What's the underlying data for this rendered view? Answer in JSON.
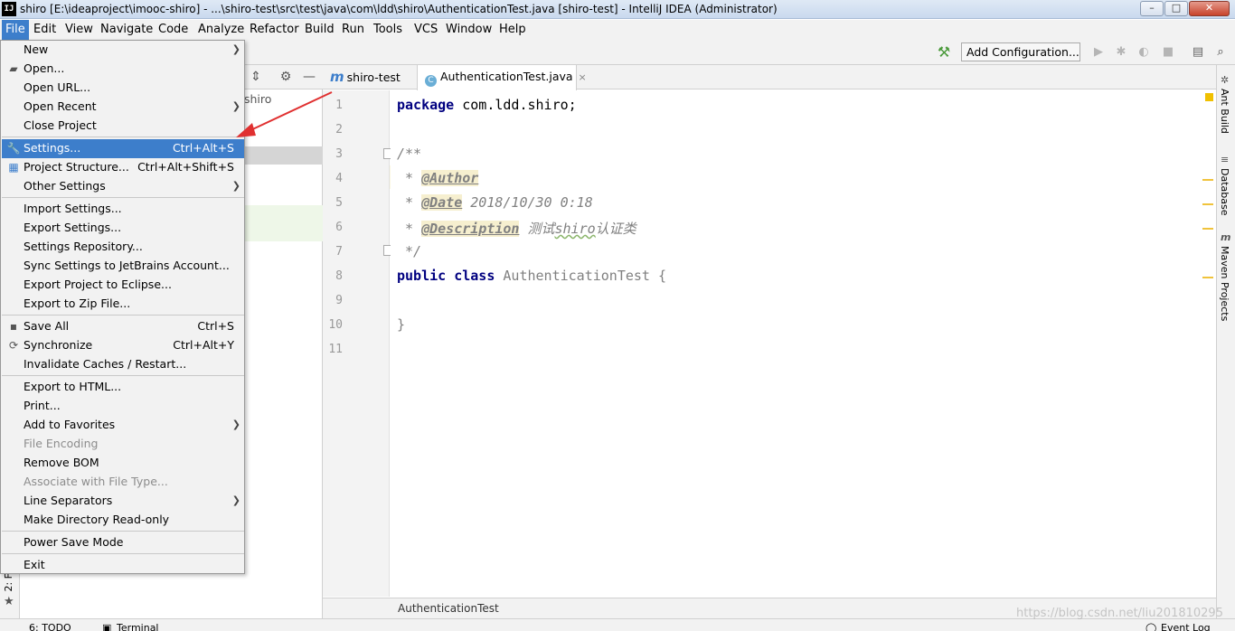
{
  "window": {
    "title": "shiro [E:\\ideaproject\\imooc-shiro] - ...\\shiro-test\\src\\test\\java\\com\\ldd\\shiro\\AuthenticationTest.java [shiro-test] - IntelliJ IDEA (Administrator)",
    "logo": "IJ",
    "min": "–",
    "max": "□",
    "close": "✕"
  },
  "menubar": [
    "File",
    "Edit",
    "View",
    "Navigate",
    "Code",
    "Analyze",
    "Refactor",
    "Build",
    "Run",
    "Tools",
    "VCS",
    "Window",
    "Help"
  ],
  "toolbar": {
    "add_configuration": "Add Configuration..."
  },
  "project": {
    "row_text": "shiro"
  },
  "tabs": [
    {
      "label": "shiro-test",
      "icon": "m"
    },
    {
      "label": "AuthenticationTest.java",
      "icon": "C",
      "close": "×"
    }
  ],
  "code": {
    "line_numbers": [
      "1",
      "2",
      "3",
      "4",
      "5",
      "6",
      "7",
      "8",
      "9",
      "10",
      "11"
    ],
    "line1_kw": "package",
    "line1_rest": " com.ldd.shiro;",
    "line3": "/**",
    "star": " * ",
    "author_tag": "@Author",
    "date_tag": "@Date",
    "date_value": " 2018/10/30 0:18",
    "desc_tag": "@Description",
    "desc_value_a": " 测试",
    "desc_value_b": "shiro",
    "desc_value_c": "认证类",
    "line7": " */",
    "line8_kw": "public class",
    "line8_name": " AuthenticationTest",
    "line8_brace": " {",
    "line10": "}"
  },
  "breadcrumb": "AuthenticationTest",
  "right_strip": [
    "Ant Build",
    "Database",
    "Maven Projects"
  ],
  "left_strip": "2: F",
  "bottombar": {
    "todo": "6: TODO",
    "terminal": "Terminal",
    "event_log": "Event Log"
  },
  "watermark": "https://blog.csdn.net/liu201810295",
  "file_menu": {
    "items": [
      {
        "label": "New",
        "shortcut": "",
        "submenu": true,
        "icon": ""
      },
      {
        "label": "Open...",
        "shortcut": "",
        "submenu": false,
        "icon": "folder-icon"
      },
      {
        "label": "Open URL...",
        "shortcut": "",
        "submenu": false,
        "icon": ""
      },
      {
        "label": "Open Recent",
        "shortcut": "",
        "submenu": true,
        "icon": ""
      },
      {
        "label": "Close Project",
        "shortcut": "",
        "submenu": false,
        "icon": ""
      },
      {
        "label": "Settings...",
        "shortcut": "Ctrl+Alt+S",
        "submenu": false,
        "icon": "wrench-icon",
        "selected": true
      },
      {
        "label": "Project Structure...",
        "shortcut": "Ctrl+Alt+Shift+S",
        "submenu": false,
        "icon": "project-structure-icon"
      },
      {
        "label": "Other Settings",
        "shortcut": "",
        "submenu": true,
        "icon": ""
      },
      {
        "label": "Import Settings...",
        "shortcut": "",
        "submenu": false,
        "icon": ""
      },
      {
        "label": "Export Settings...",
        "shortcut": "",
        "submenu": false,
        "icon": ""
      },
      {
        "label": "Settings Repository...",
        "shortcut": "",
        "submenu": false,
        "icon": ""
      },
      {
        "label": "Sync Settings to JetBrains Account...",
        "shortcut": "",
        "submenu": false,
        "icon": ""
      },
      {
        "label": "Export Project to Eclipse...",
        "shortcut": "",
        "submenu": false,
        "icon": ""
      },
      {
        "label": "Export to Zip File...",
        "shortcut": "",
        "submenu": false,
        "icon": ""
      },
      {
        "label": "Save All",
        "shortcut": "Ctrl+S",
        "submenu": false,
        "icon": "save-icon"
      },
      {
        "label": "Synchronize",
        "shortcut": "Ctrl+Alt+Y",
        "submenu": false,
        "icon": "sync-icon"
      },
      {
        "label": "Invalidate Caches / Restart...",
        "shortcut": "",
        "submenu": false,
        "icon": ""
      },
      {
        "label": "Export to HTML...",
        "shortcut": "",
        "submenu": false,
        "icon": ""
      },
      {
        "label": "Print...",
        "shortcut": "",
        "submenu": false,
        "icon": ""
      },
      {
        "label": "Add to Favorites",
        "shortcut": "",
        "submenu": true,
        "icon": ""
      },
      {
        "label": "File Encoding",
        "shortcut": "",
        "submenu": false,
        "icon": "",
        "disabled": true
      },
      {
        "label": "Remove BOM",
        "shortcut": "",
        "submenu": false,
        "icon": ""
      },
      {
        "label": "Associate with File Type...",
        "shortcut": "",
        "submenu": false,
        "icon": "",
        "disabled": true
      },
      {
        "label": "Line Separators",
        "shortcut": "",
        "submenu": true,
        "icon": ""
      },
      {
        "label": "Make Directory Read-only",
        "shortcut": "",
        "submenu": false,
        "icon": ""
      },
      {
        "label": "Power Save Mode",
        "shortcut": "",
        "submenu": false,
        "icon": ""
      },
      {
        "label": "Exit",
        "shortcut": "",
        "submenu": false,
        "icon": ""
      }
    ]
  },
  "colors": {
    "accent": "#3d7ecb",
    "keyword": "#000080",
    "comment": "#808080",
    "annotation_arrow": "#e03030"
  }
}
